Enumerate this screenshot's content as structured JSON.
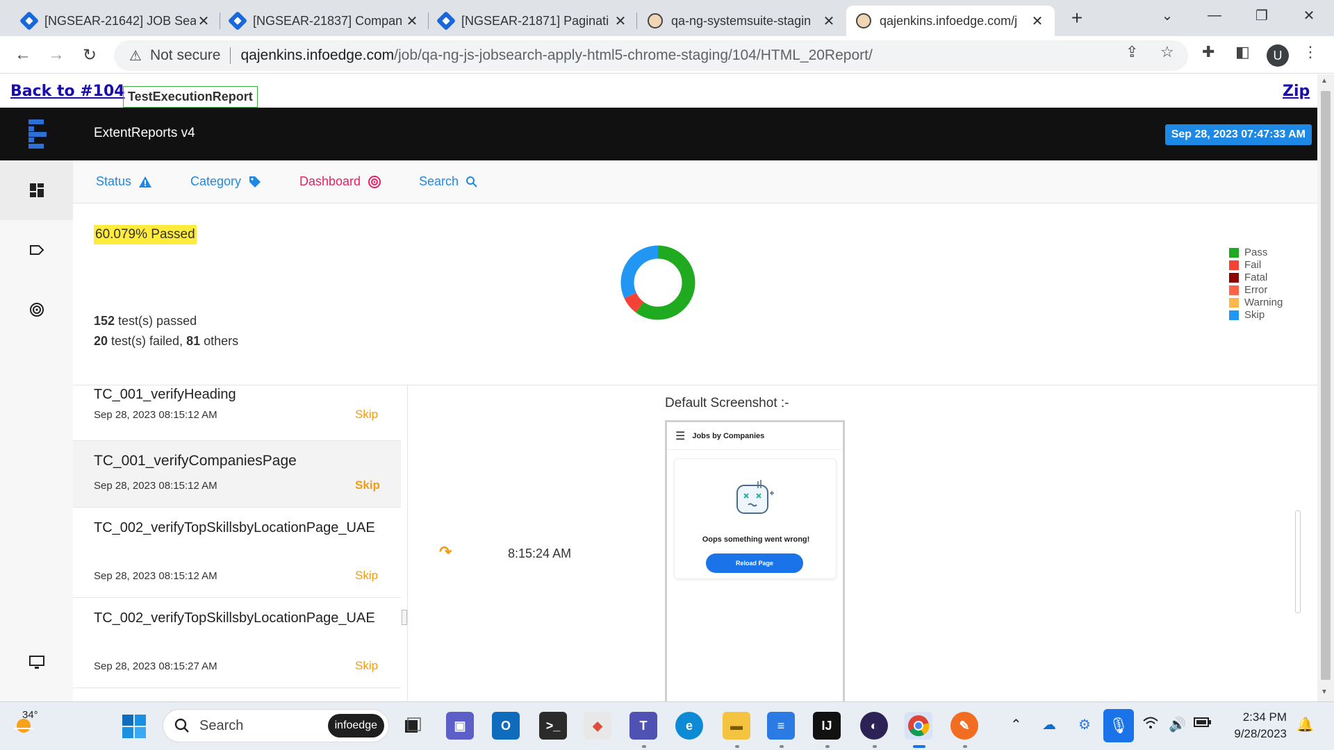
{
  "browser": {
    "tabs": [
      {
        "title": "[NGSEAR-21642] JOB Sear",
        "icon": "jira-icon"
      },
      {
        "title": "[NGSEAR-21837] Compan",
        "icon": "jira-icon"
      },
      {
        "title": "[NGSEAR-21871] Paginati",
        "icon": "jira-icon"
      },
      {
        "title": "qa-ng-systemsuite-stagin",
        "icon": "jenkins-icon"
      },
      {
        "title": "qajenkins.infoedge.com/j",
        "icon": "jenkins-icon",
        "active": true
      }
    ],
    "address": {
      "security": "Not secure",
      "host": "qajenkins.infoedge.com",
      "path": "/job/qa-ng-js-jobsearch-apply-html5-chrome-staging/104/HTML_20Report/"
    },
    "profile_initial": "U"
  },
  "jenkins": {
    "back_label": "Back to #104",
    "report_tab": "TestExecutionReport",
    "zip_label": "Zip"
  },
  "report": {
    "brand": "ExtentReports v4",
    "date": "Sep 28, 2023 07:47:33 AM",
    "filters": [
      {
        "label": "Status",
        "icon": "warning-icon",
        "color": "#1e88e5"
      },
      {
        "label": "Category",
        "icon": "tag-icon",
        "color": "#1e88e5"
      },
      {
        "label": "Dashboard",
        "icon": "target-icon",
        "color": "#e91e63"
      },
      {
        "label": "Search",
        "icon": "search-icon",
        "color": "#1e88e5"
      }
    ],
    "pass_pct": "60.079% Passed",
    "passed_count": "152",
    "passed_text": " test(s) passed",
    "failed_count": "20",
    "failed_text": " test(s) failed, ",
    "others_count": "81",
    "others_text": " others",
    "legend": [
      {
        "label": "Pass",
        "color": "#1faa1f"
      },
      {
        "label": "Fail",
        "color": "#f44336"
      },
      {
        "label": "Fatal",
        "color": "#8b0000"
      },
      {
        "label": "Error",
        "color": "#ff6347"
      },
      {
        "label": "Warning",
        "color": "#ffb74d"
      },
      {
        "label": "Skip",
        "color": "#2196f3"
      }
    ],
    "chart_data": {
      "type": "pie",
      "categories": [
        "Pass",
        "Fail",
        "Fatal",
        "Error",
        "Warning",
        "Skip"
      ],
      "values": [
        152,
        20,
        0,
        0,
        0,
        81
      ]
    },
    "tests": [
      {
        "name": "TC_001_verifyHeading",
        "date": "Sep 28, 2023 08:15:12 AM",
        "status": "Skip"
      },
      {
        "name": "TC_001_verifyCompaniesPage",
        "date": "Sep 28, 2023 08:15:12 AM",
        "status": "Skip",
        "selected": true
      },
      {
        "name": "TC_002_verifyTopSkillsbyLocationPage_UAE",
        "date": "Sep 28, 2023 08:15:12 AM",
        "status": "Skip"
      },
      {
        "name": "TC_002_verifyTopSkillsbyLocationPage_UAE",
        "date": "Sep 28, 2023 08:15:27 AM",
        "status": "Skip"
      }
    ],
    "detail": {
      "log_time": "8:15:24 AM",
      "screenshot_label": "Default Screenshot :-",
      "shot_title": "Jobs by Companies",
      "shot_message": "Oops something went wrong!",
      "shot_button": "Reload Page"
    }
  },
  "taskbar": {
    "temperature": "34°",
    "search_placeholder": "Search",
    "search_badge": "infoedge",
    "time": "2:34 PM",
    "date": "9/28/2023"
  }
}
